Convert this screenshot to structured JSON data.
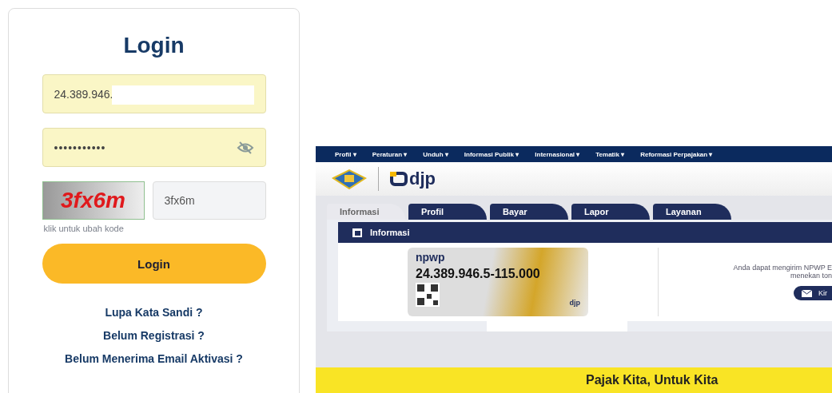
{
  "login": {
    "title": "Login",
    "username": {
      "value": "24.389.946."
    },
    "password": {
      "value": "•••••••••••"
    },
    "captcha": {
      "image_text": "3fx6m",
      "value": "3fx6m",
      "hint": "klik untuk ubah kode"
    },
    "button": "Login",
    "links": [
      "Lupa Kata Sandi ?",
      "Belum Registrasi ?",
      "Belum Menerima Email Aktivasi ?"
    ]
  },
  "portal": {
    "nav": [
      "Profil ▾",
      "Peraturan ▾",
      "Unduh ▾",
      "Informasi Publik ▾",
      "Internasional ▾",
      "Tematik ▾",
      "Reformasi Perpajakan ▾"
    ],
    "logo_text": "djp",
    "tabs": [
      {
        "label": "Informasi",
        "selected": true
      },
      {
        "label": "Profil",
        "selected": false
      },
      {
        "label": "Bayar",
        "selected": false
      },
      {
        "label": "Lapor",
        "selected": false
      },
      {
        "label": "Layanan",
        "selected": false
      }
    ],
    "panel": {
      "title": "Informasi",
      "card": {
        "brand": "npwp",
        "number": "24.389.946.5-115.000",
        "logo_text": "djp"
      },
      "message_lines": [
        "Anda dapat mengirim NPWP E",
        "menekan ton"
      ],
      "send_button": "Kir"
    },
    "banner": "Pajak Kita, Untuk Kita"
  }
}
